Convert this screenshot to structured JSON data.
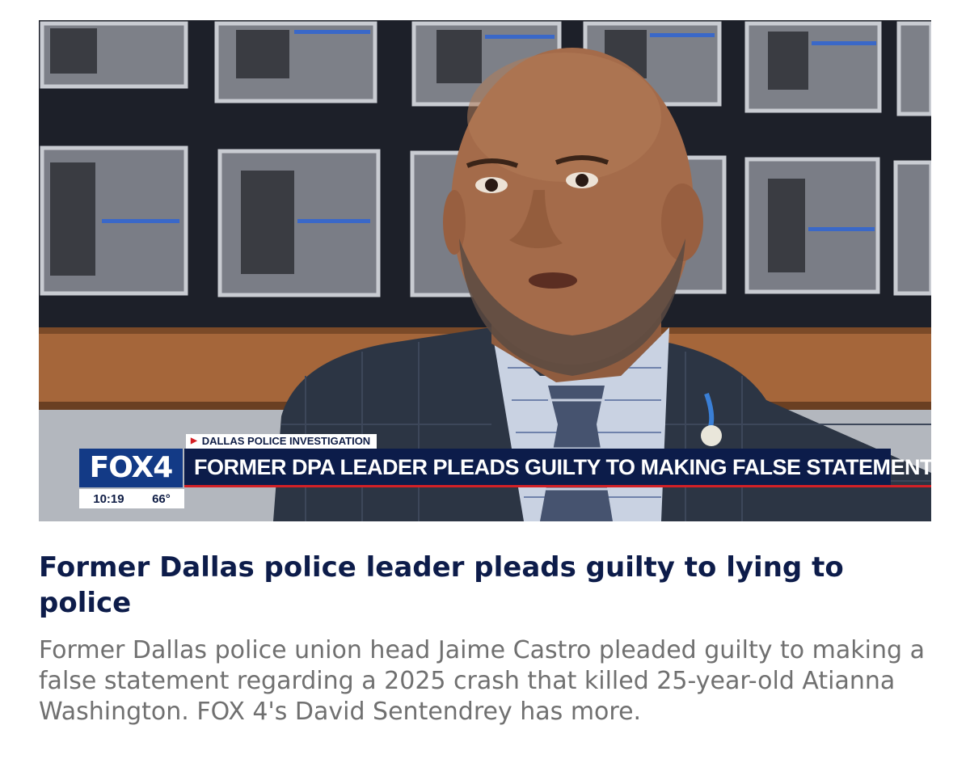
{
  "video": {
    "network_logo": "FOX4",
    "kicker": "DALLAS POLICE INVESTIGATION",
    "chyron_headline": "FORMER DPA LEADER PLEADS GUILTY TO MAKING FALSE STATEMENT",
    "time": "10:19",
    "temperature": "66°",
    "colors": {
      "brand_blue": "#133a86",
      "chyron_navy": "#0c1c4a",
      "accent_red": "#d42026"
    }
  },
  "article": {
    "title": "Former Dallas police leader pleads guilty to lying to police",
    "summary": "Former Dallas police union head Jaime Castro pleaded guilty to making a false statement regarding a 2025 crash that killed 25-year-old Atianna Washington. FOX 4's David Sentendrey has more."
  }
}
